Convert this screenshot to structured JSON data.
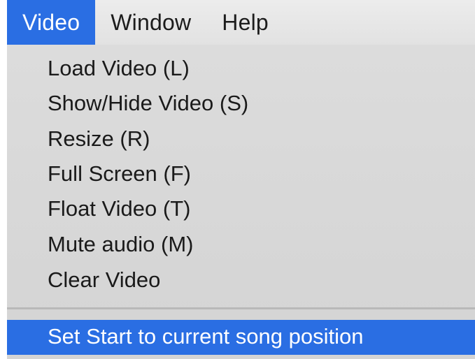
{
  "menubar": {
    "items": [
      {
        "label": "Video",
        "active": true
      },
      {
        "label": "Window",
        "active": false
      },
      {
        "label": "Help",
        "active": false
      }
    ]
  },
  "video_menu": {
    "items": [
      {
        "label": "Load Video (L)"
      },
      {
        "label": "Show/Hide Video (S)"
      },
      {
        "label": "Resize (R)"
      },
      {
        "label": "Full Screen (F)"
      },
      {
        "label": "Float Video (T)"
      },
      {
        "label": "Mute audio (M)"
      },
      {
        "label": "Clear Video"
      }
    ],
    "highlighted_item": {
      "label": "Set Start to current song position"
    }
  },
  "colors": {
    "selection": "#2a6ee3",
    "menu_background": "#d8d8d8",
    "menubar_background": "#e6e6e6",
    "text": "#1a1a1a",
    "selected_text": "#ffffff"
  }
}
